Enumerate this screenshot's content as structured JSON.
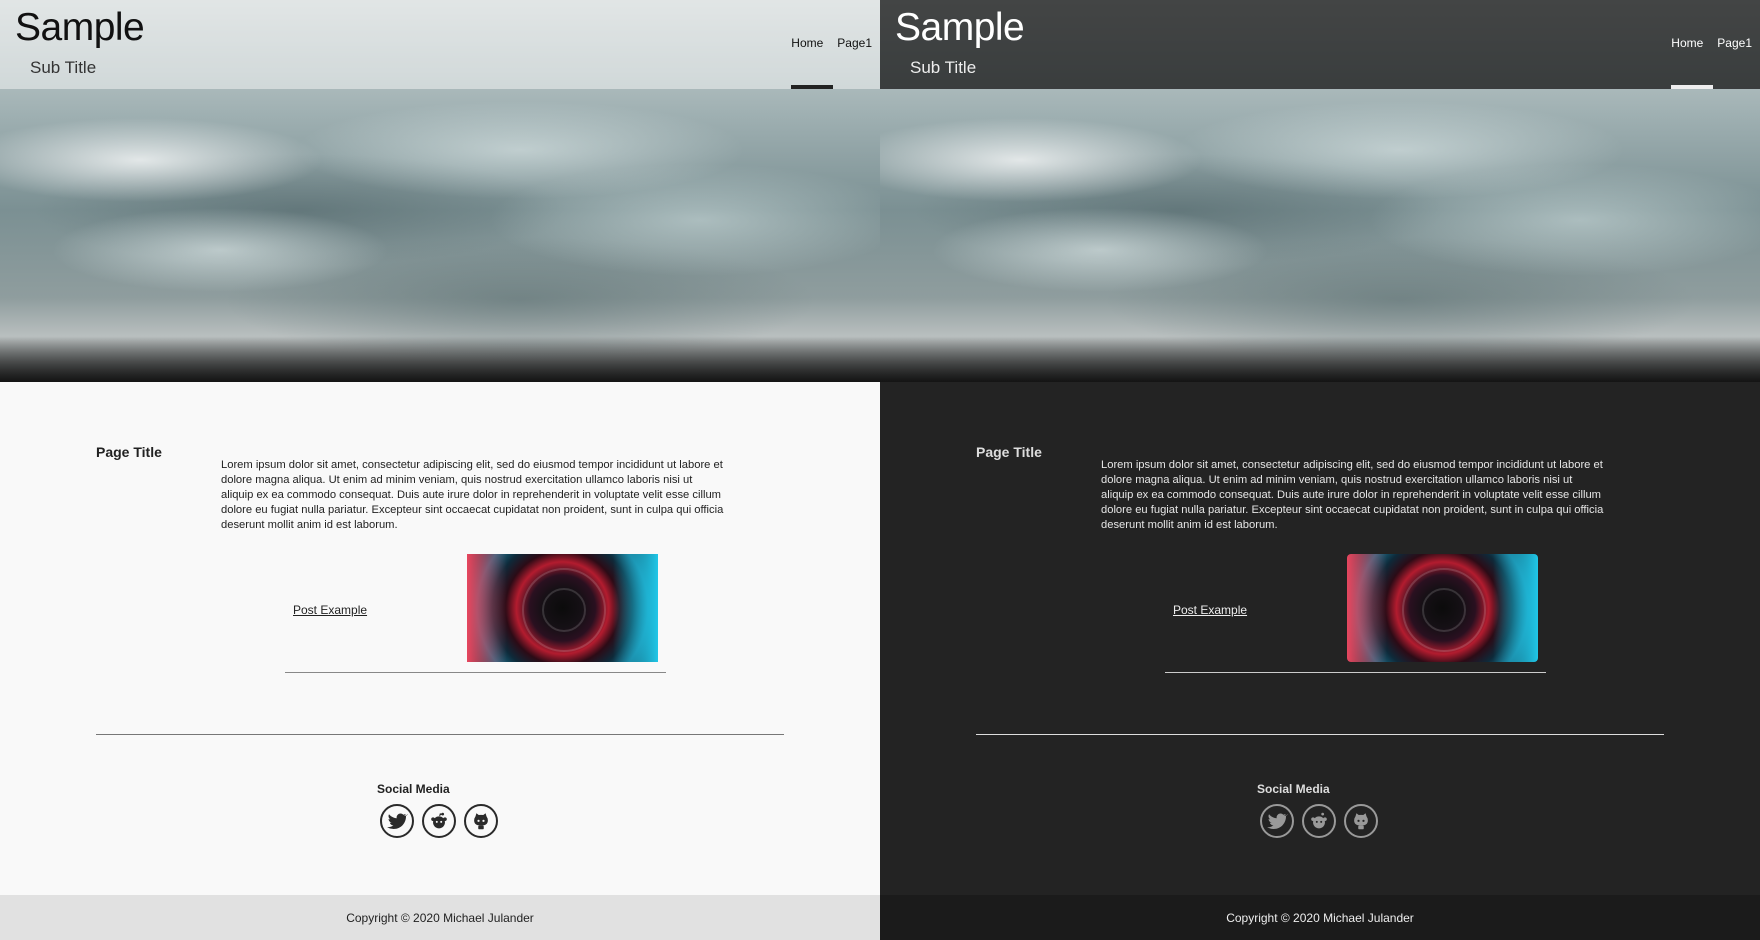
{
  "site": {
    "title": "Sample",
    "subtitle": "Sub Title"
  },
  "nav": {
    "items": [
      {
        "label": "Home",
        "active": true
      },
      {
        "label": "Page1",
        "active": false
      }
    ]
  },
  "content": {
    "page_title": "Page Title",
    "body": "Lorem ipsum dolor sit amet, consectetur adipiscing elit, sed do eiusmod tempor incididunt ut labore et dolore magna aliqua. Ut enim ad minim veniam, quis nostrud exercitation ullamco laboris nisi ut aliquip ex ea commodo consequat. Duis aute irure dolor in reprehenderit in voluptate velit esse cillum dolore eu fugiat nulla pariatur. Excepteur sint occaecat cupidatat non proident, sunt in culpa qui officia deserunt mollit anim id est laborum.",
    "post": {
      "link_label": "Post Example",
      "image_icon": "camera-lens-image"
    }
  },
  "social": {
    "title": "Social Media",
    "icons": [
      "twitter-icon",
      "reddit-icon",
      "github-icon"
    ]
  },
  "footer": {
    "copyright": "Copyright © 2020 Michael Julander"
  },
  "themes": {
    "light_background": "#f9f9f9",
    "dark_background": "#232323"
  }
}
